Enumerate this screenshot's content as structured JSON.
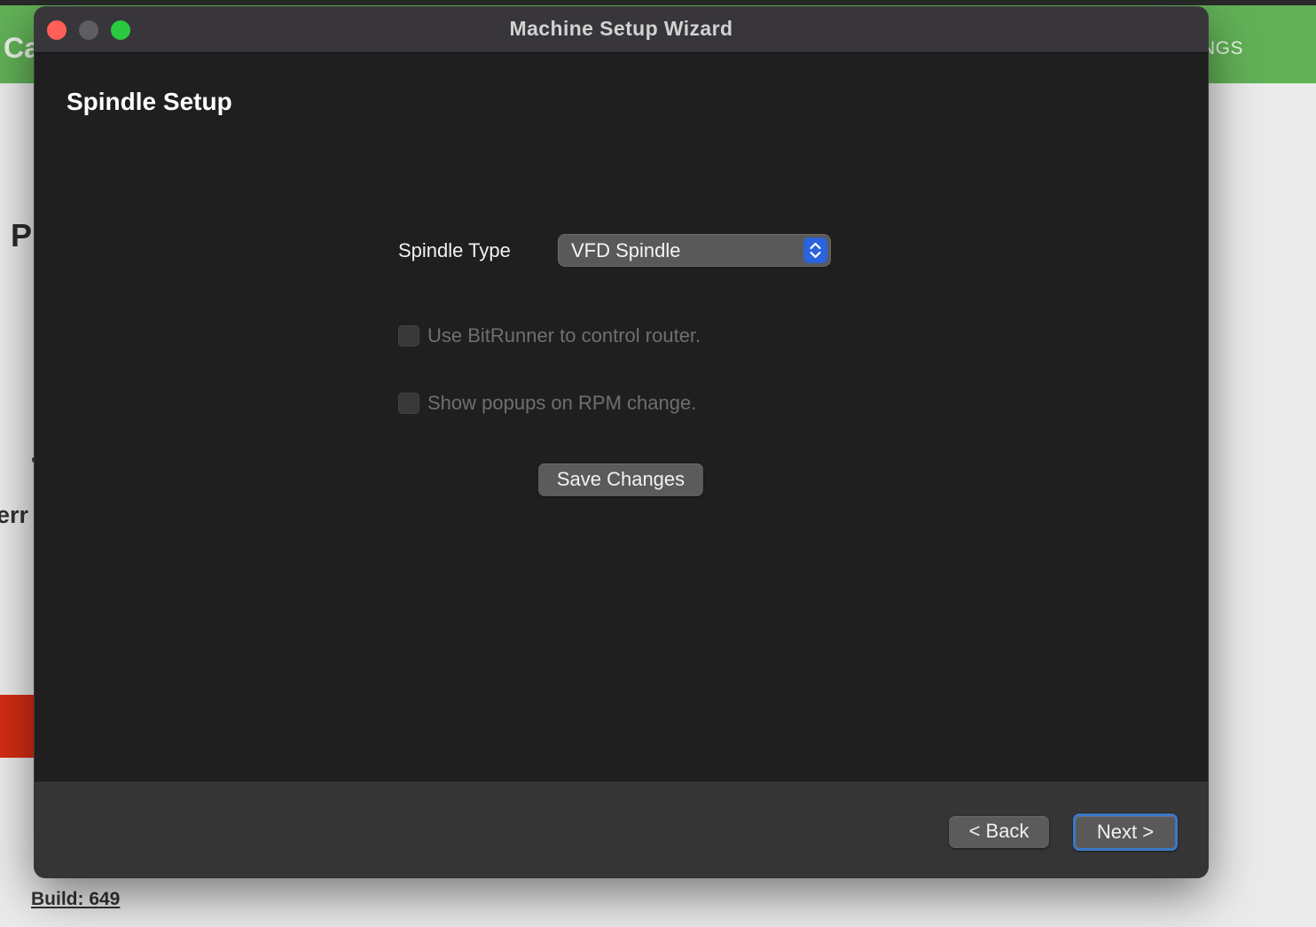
{
  "background_app": {
    "logo_text": "Ca",
    "nav_text": "NGS",
    "heading_text": "P",
    "dot_text": "'",
    "body_text": "err",
    "build_label": "Build: 649",
    "colors": {
      "header": "#62b157",
      "alert_bar": "#d52d12"
    }
  },
  "window": {
    "title": "Machine Setup Wizard",
    "controls": [
      "close",
      "minimize",
      "maximize"
    ]
  },
  "page": {
    "title": "Spindle Setup",
    "spindle_type": {
      "label": "Spindle Type",
      "selected": "VFD Spindle",
      "icon": "up-down-chevron-icon"
    },
    "checkboxes": [
      {
        "label": "Use BitRunner to control router.",
        "checked": false,
        "enabled": false
      },
      {
        "label": "Show popups on RPM change.",
        "checked": false,
        "enabled": false
      }
    ],
    "save_button": "Save Changes"
  },
  "footer": {
    "back_button": "< Back",
    "next_button": "Next >"
  },
  "colors": {
    "window_bg": "#1f1f1f",
    "footer_bg": "#353535",
    "accent": "#2a63de"
  }
}
